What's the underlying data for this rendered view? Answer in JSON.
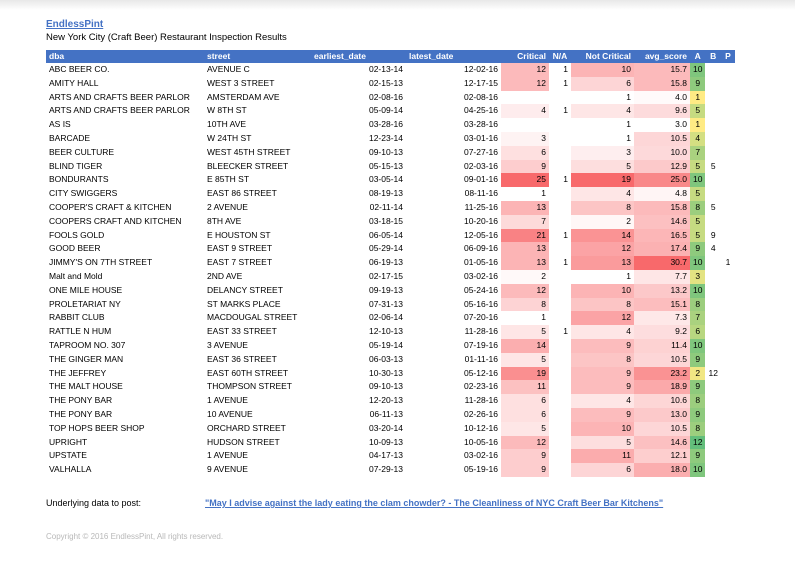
{
  "brand": "EndlessPint",
  "subtitle": "New York City (Craft Beer) Restaurant Inspection Results",
  "columns": [
    "dba",
    "street",
    "earliest_date",
    "latest_date",
    "Critical",
    "N/A",
    "Not Critical",
    "avg_score",
    "A",
    "B",
    "P"
  ],
  "rows": [
    [
      "ABC BEER CO.",
      "AVENUE C",
      "02-13-14",
      "12-02-16",
      "12",
      "1",
      "10",
      "15.7",
      "10",
      "",
      ""
    ],
    [
      "AMITY HALL",
      "WEST   3 STREET",
      "02-15-13",
      "12-17-15",
      "12",
      "1",
      "6",
      "15.8",
      "9",
      "",
      ""
    ],
    [
      "ARTS AND CRAFTS BEER PARLOR",
      "AMSTERDAM AVE",
      "02-08-16",
      "02-08-16",
      "",
      "",
      "1",
      "4.0",
      "1",
      "",
      ""
    ],
    [
      "ARTS AND CRAFTS BEER PARLOR",
      "W 8TH ST",
      "05-09-14",
      "04-25-16",
      "4",
      "1",
      "4",
      "9.6",
      "5",
      "",
      ""
    ],
    [
      "AS IS",
      "10TH AVE",
      "03-28-16",
      "03-28-16",
      "",
      "",
      "1",
      "3.0",
      "1",
      "",
      ""
    ],
    [
      "BARCADE",
      "W 24TH ST",
      "12-23-14",
      "03-01-16",
      "3",
      "",
      "1",
      "10.5",
      "4",
      "",
      ""
    ],
    [
      "BEER CULTURE",
      "WEST 45TH STREET",
      "09-10-13",
      "07-27-16",
      "6",
      "",
      "3",
      "10.0",
      "7",
      "",
      ""
    ],
    [
      "BLIND TIGER",
      "BLEECKER STREET",
      "05-15-13",
      "02-03-16",
      "9",
      "",
      "5",
      "12.9",
      "5",
      "5",
      ""
    ],
    [
      "BONDURANTS",
      "E 85TH ST",
      "03-05-14",
      "09-01-16",
      "25",
      "1",
      "19",
      "25.0",
      "10",
      "",
      ""
    ],
    [
      "CITY SWIGGERS",
      "EAST  86 STREET",
      "08-19-13",
      "08-11-16",
      "1",
      "",
      "4",
      "4.8",
      "5",
      "",
      ""
    ],
    [
      "COOPER'S CRAFT & KITCHEN",
      "2 AVENUE",
      "02-11-14",
      "11-25-16",
      "13",
      "",
      "8",
      "15.8",
      "8",
      "5",
      ""
    ],
    [
      "COOPERS CRAFT AND KITCHEN",
      "8TH AVE",
      "03-18-15",
      "10-20-16",
      "7",
      "",
      "2",
      "14.6",
      "5",
      "",
      ""
    ],
    [
      "FOOLS GOLD",
      "E HOUSTON ST",
      "06-05-14",
      "12-05-16",
      "21",
      "1",
      "14",
      "16.5",
      "5",
      "9",
      ""
    ],
    [
      "GOOD BEER",
      "EAST   9 STREET",
      "05-29-14",
      "06-09-16",
      "13",
      "",
      "12",
      "17.4",
      "9",
      "4",
      ""
    ],
    [
      "JIMMY'S ON 7TH STREET",
      "EAST   7 STREET",
      "06-19-13",
      "01-05-16",
      "13",
      "1",
      "13",
      "30.7",
      "10",
      "",
      "1"
    ],
    [
      "Malt and Mold",
      "2ND AVE",
      "02-17-15",
      "03-02-16",
      "2",
      "",
      "1",
      "7.7",
      "3",
      "",
      ""
    ],
    [
      "ONE MILE HOUSE",
      "DELANCY STREET",
      "09-19-13",
      "05-24-16",
      "12",
      "",
      "10",
      "13.2",
      "10",
      "",
      ""
    ],
    [
      "PROLETARIAT NY",
      "ST MARKS PLACE",
      "07-31-13",
      "05-16-16",
      "8",
      "",
      "8",
      "15.1",
      "8",
      "",
      ""
    ],
    [
      "RABBIT CLUB",
      "MACDOUGAL STREET",
      "02-06-14",
      "07-20-16",
      "1",
      "",
      "12",
      "7.3",
      "7",
      "",
      ""
    ],
    [
      "RATTLE N HUM",
      "EAST  33 STREET",
      "12-10-13",
      "11-28-16",
      "5",
      "1",
      "4",
      "9.2",
      "6",
      "",
      ""
    ],
    [
      "TAPROOM NO. 307",
      "3 AVENUE",
      "05-19-14",
      "07-19-16",
      "14",
      "",
      "9",
      "11.4",
      "10",
      "",
      ""
    ],
    [
      "THE GINGER MAN",
      "EAST  36 STREET",
      "06-03-13",
      "01-11-16",
      "5",
      "",
      "8",
      "10.5",
      "9",
      "",
      ""
    ],
    [
      "THE JEFFREY",
      "EAST 60TH STREET",
      "10-30-13",
      "05-12-16",
      "19",
      "",
      "9",
      "23.2",
      "2",
      "12",
      ""
    ],
    [
      "THE MALT HOUSE",
      "THOMPSON STREET",
      "09-10-13",
      "02-23-16",
      "11",
      "",
      "9",
      "18.9",
      "9",
      "",
      ""
    ],
    [
      "THE PONY BAR",
      "1 AVENUE",
      "12-20-13",
      "11-28-16",
      "6",
      "",
      "4",
      "10.6",
      "8",
      "",
      ""
    ],
    [
      "THE PONY BAR",
      "10 AVENUE",
      "06-11-13",
      "02-26-16",
      "6",
      "",
      "9",
      "13.0",
      "9",
      "",
      ""
    ],
    [
      "TOP HOPS BEER SHOP",
      "ORCHARD STREET",
      "03-20-14",
      "10-12-16",
      "5",
      "",
      "10",
      "10.5",
      "8",
      "",
      ""
    ],
    [
      "UPRIGHT",
      "HUDSON STREET",
      "10-09-13",
      "10-05-16",
      "12",
      "",
      "5",
      "14.6",
      "12",
      "",
      ""
    ],
    [
      "UPSTATE",
      "1 AVENUE",
      "04-17-13",
      "03-02-16",
      "9",
      "",
      "11",
      "12.1",
      "9",
      "",
      ""
    ],
    [
      "VALHALLA",
      "9 AVENUE",
      "07-29-13",
      "05-19-16",
      "9",
      "",
      "6",
      "18.0",
      "10",
      "",
      ""
    ]
  ],
  "footer": {
    "label": "Underlying data to post:",
    "link_text": "\"May I advise against the lady eating the clam chowder? - The Cleanliness of NYC Craft Beer Bar Kitchens\"",
    "copyright": "Copyright © 2016 EndlessPint, All rights reserved."
  },
  "colors": {
    "header_bg": "#4472c4",
    "header_text": "#ffffff",
    "low": "#ffffff",
    "high": "#f8696b",
    "grade_low": "#ffeb84",
    "grade_high": "#63be7b",
    "link": "#4472c4"
  }
}
